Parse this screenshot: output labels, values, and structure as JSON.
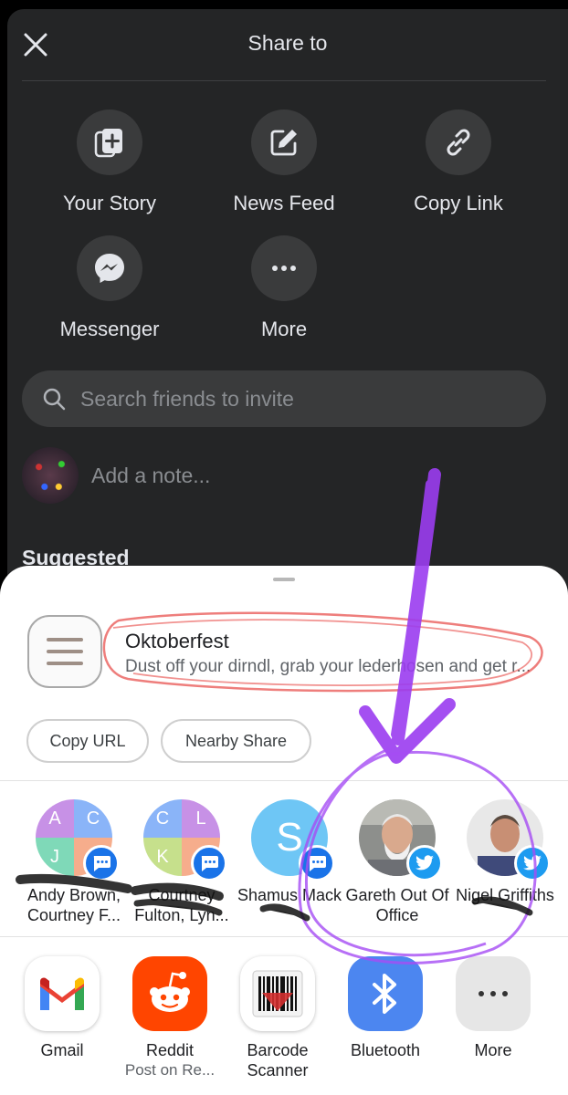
{
  "fb_share": {
    "title": "Share to",
    "options": [
      {
        "label": "Your Story",
        "icon": "add-story-icon"
      },
      {
        "label": "News Feed",
        "icon": "edit-post-icon"
      },
      {
        "label": "Copy Link",
        "icon": "link-icon"
      },
      {
        "label": "Messenger",
        "icon": "messenger-icon"
      },
      {
        "label": "More",
        "icon": "more-dots-icon"
      }
    ],
    "search_placeholder": "Search friends to invite",
    "note_placeholder": "Add a note...",
    "suggested_heading": "Suggested"
  },
  "android_share": {
    "preview": {
      "title": "Oktoberfest",
      "subtitle": "Dust off your dirndl, grab your lederhosen and get r..."
    },
    "actions": {
      "copy_url": "Copy URL",
      "nearby_share": "Nearby Share"
    },
    "direct_share": [
      {
        "name": "Andy Brown, Courtney F...",
        "initials": [
          "A",
          "C",
          "J",
          ""
        ],
        "badge": "messages-icon"
      },
      {
        "name": "Courtney Fulton, Lyn...",
        "initials": [
          "C",
          "L",
          "K",
          ""
        ],
        "badge": "messages-icon"
      },
      {
        "name": "Shamus Mack",
        "initial": "S",
        "badge": "messages-icon"
      },
      {
        "name": "Gareth Out Of Office",
        "badge": "twitter-icon"
      },
      {
        "name": "Nigel Griffiths",
        "badge": "twitter-icon"
      }
    ],
    "apps": [
      {
        "name": "Gmail",
        "sub": ""
      },
      {
        "name": "Reddit",
        "sub": "Post on Re..."
      },
      {
        "name": "Barcode Scanner",
        "sub": ""
      },
      {
        "name": "Bluetooth",
        "sub": ""
      },
      {
        "name": "More",
        "sub": ""
      }
    ]
  },
  "colors": {
    "fb_background": "#242526",
    "fb_button": "#3a3b3c",
    "sheet_background": "#ffffff",
    "messages_badge": "#1a73e8",
    "twitter_badge": "#1d9bf0",
    "annotation_purple": "#9b3df0",
    "annotation_red": "#e53935"
  }
}
